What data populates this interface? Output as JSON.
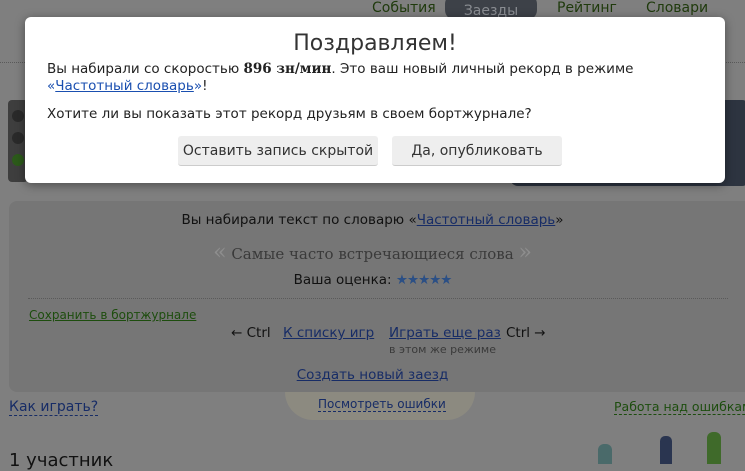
{
  "nav": {
    "items": [
      "События",
      "Заезды",
      "Рейтинг",
      "Словари"
    ],
    "active": "Заезды"
  },
  "modal": {
    "title": "Поздравляем!",
    "speed_prefix": "Вы набирали со скоростью ",
    "speed": "896 зн/мин",
    "speed_suffix": ". Это ваш новый личный рекорд в режиме ",
    "mode_open": "«",
    "mode": "Частотный словарь",
    "mode_close": "»",
    "excl": "!",
    "question": "Хотите ли вы показать этот рекорд друзьям в своем бортжурнале?",
    "hide_button": "Оставить запись скрытой",
    "publish_button": "Да, опубликовать"
  },
  "result": {
    "dict_prefix": "Вы набирали текст по словарю «",
    "dict": "Частотный словарь",
    "dict_suffix": "»",
    "description": "Самые часто встречающиеся слова",
    "rating_label": "Ваша оценка:",
    "rating": 5,
    "stars": "★★★★★",
    "save": "Сохранить в бортжурнале",
    "ctrl_left": "← Ctrl",
    "to_list": "К списку игр",
    "play_again": "Играть еще раз",
    "same_mode": "в этом же режиме",
    "ctrl_right": "Ctrl →",
    "create": "Создать новый заезд"
  },
  "bottom": {
    "how": "Как играть?",
    "errors": "Посмотреть ошибки",
    "work": "Работа над ошибками",
    "participants": "1 участник"
  }
}
